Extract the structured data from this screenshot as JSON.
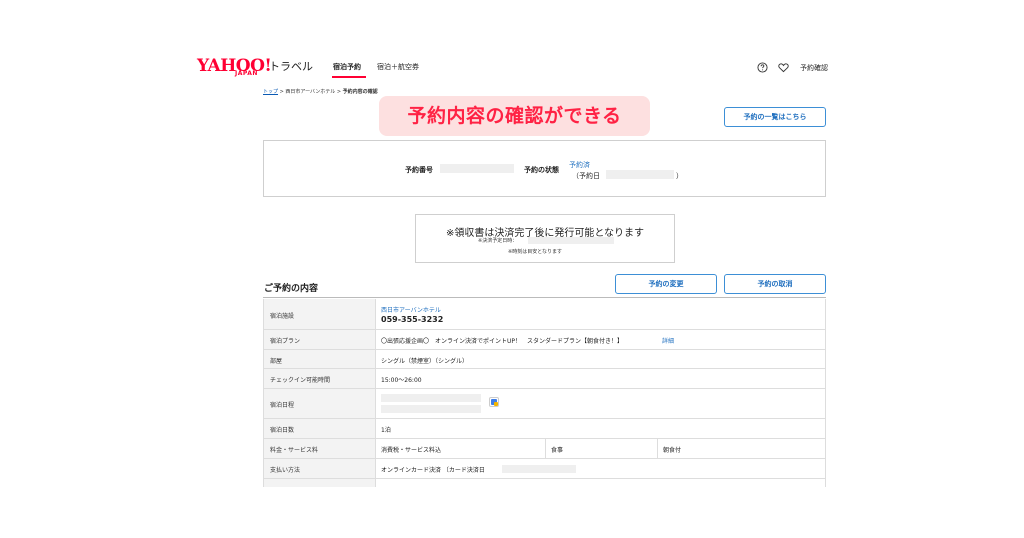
{
  "header": {
    "logo_yahoo": "YAHOO!",
    "logo_japan": "JAPAN",
    "logo_service": "トラベル",
    "nav": [
      {
        "label": "宿泊予約"
      },
      {
        "label": "宿泊＋航空券"
      }
    ],
    "confirm_label": "予約確認",
    "help_icon": "help-circle-icon",
    "favorite_icon": "heart-icon",
    "accent_color": "#ff0033"
  },
  "breadcrumb": {
    "top": "トップ",
    "hotel": "西日市アーバンホテル",
    "current": "予約内容の確認"
  },
  "banner": {
    "text": "予約内容の確認ができる"
  },
  "buttons": {
    "reservation_list": "予約の一覧はこちら",
    "change": "予約の変更",
    "cancel": "予約の取消"
  },
  "reservation_summary": {
    "number_label": "予約番号",
    "status_label": "予約の状態",
    "status_value": "予約済",
    "reserved_date_prefix": "（予約日",
    "reserved_date_suffix": "）"
  },
  "receipt_notice": {
    "title": "※領収書は決済完了後に発行可能となります",
    "scheduled_label": "※決済予定日時：",
    "note": "※時刻は目安となります"
  },
  "details": {
    "title": "ご予約の内容",
    "rows": {
      "facility": {
        "label": "宿泊施設",
        "name": "西日市アーバンホテル",
        "phone": "059-355-3232"
      },
      "plan": {
        "label": "宿泊プラン",
        "value": "〇出張応援企画〇　オンライン決済でポイントUP！　スタンダードプラン【朝食付き！】",
        "detail": "詳細"
      },
      "room": {
        "label": "部屋",
        "value": "シングル（禁煙室）（シングル）"
      },
      "checkin": {
        "label": "チェックイン可能時間",
        "value": "15:00〜26:00"
      },
      "dates": {
        "label": "宿泊日程",
        "calendar_icon": "google-calendar-icon"
      },
      "nights": {
        "label": "宿泊日数",
        "value": "1泊"
      },
      "fees": {
        "label": "料金・サービス料",
        "value": "消費税・サービス料込",
        "meal_label": "食事",
        "meal_value": "朝食付"
      },
      "payment": {
        "label": "支払い方法",
        "value": "オンラインカード決済 〔カード決済日"
      }
    }
  }
}
